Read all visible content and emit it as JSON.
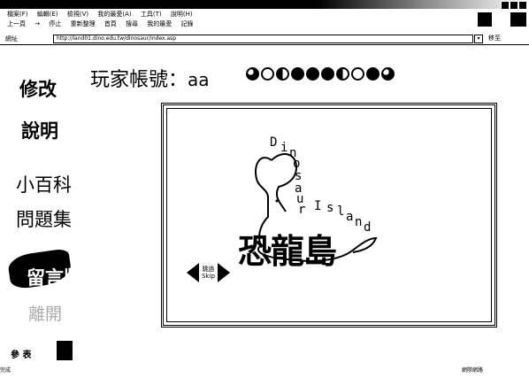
{
  "browser": {
    "title": "",
    "menu": [
      "檔案(F)",
      "編輯(E)",
      "檢視(V)",
      "我的最愛(A)",
      "工具(T)",
      "說明(H)"
    ],
    "toolbar": [
      "上一頁",
      "→",
      "停止",
      "重新整理",
      "首頁",
      "搜尋",
      "我的最愛",
      "記錄"
    ],
    "address_label": "網址",
    "address_value": "http://land01.dino.edu.tw/dinosaur/index.asp",
    "go_label": "移至"
  },
  "nav": {
    "items": [
      {
        "label": "修改"
      },
      {
        "label": "說明"
      },
      {
        "label": "小百科"
      },
      {
        "label": "問題集"
      },
      {
        "label": "留言版"
      },
      {
        "label": "離開"
      }
    ],
    "footer": "參 表"
  },
  "header": {
    "player_label": "玩家帳號：",
    "player_name": "aa",
    "progress_balls": [
      "quarter",
      "empty",
      "half",
      "full",
      "full",
      "full",
      "half",
      "empty",
      "full",
      "quarter"
    ]
  },
  "logo": {
    "title_cn": "恐龍島",
    "arc_text": [
      "D",
      "i",
      "n",
      "o",
      "s",
      "a",
      "u",
      "r",
      "I",
      "s",
      "l",
      "a",
      "n",
      "d"
    ]
  },
  "skip": {
    "line1": "跳過",
    "line2": "Skip"
  },
  "status": {
    "left": "完成",
    "right": "網際網路"
  }
}
